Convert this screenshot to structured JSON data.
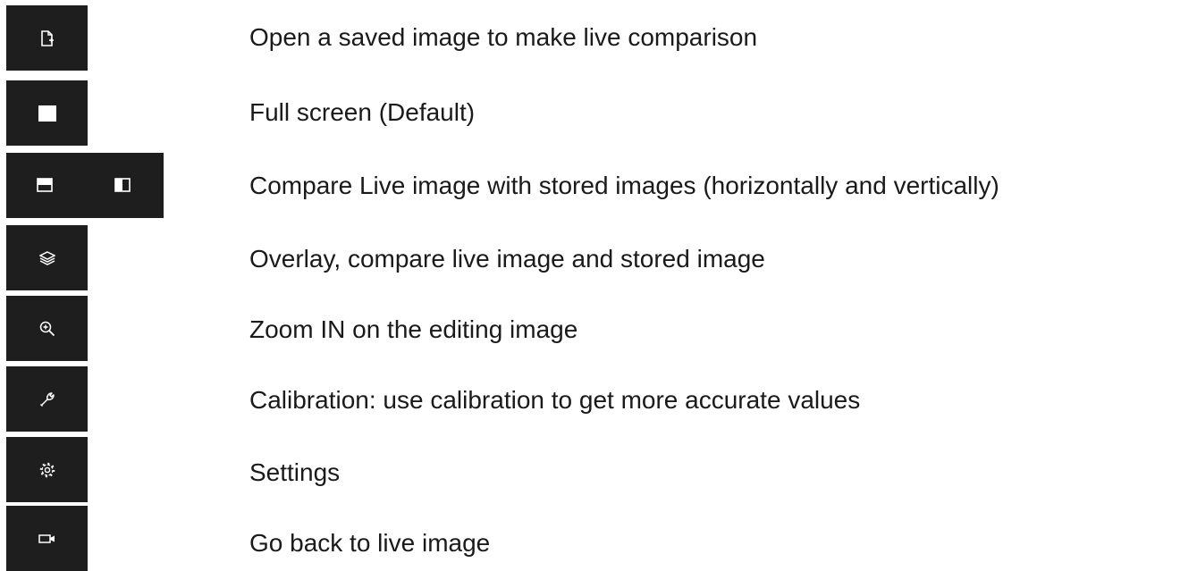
{
  "rows": [
    {
      "icon": "open-file-icon",
      "label": "Open a saved image to make live comparison"
    },
    {
      "icon": "full-screen-icon",
      "label": "Full screen (Default)"
    },
    {
      "icon": "split-horizontal-icon",
      "icon2": "split-vertical-icon",
      "label": "Compare Live image with stored images (horizontally and vertically)"
    },
    {
      "icon": "layers-icon",
      "label": "Overlay, compare live image and stored image"
    },
    {
      "icon": "zoom-in-icon",
      "label": "Zoom IN on the editing image"
    },
    {
      "icon": "wrench-icon",
      "label": "Calibration: use calibration to get more accurate values"
    },
    {
      "icon": "gear-icon",
      "label": "Settings"
    },
    {
      "icon": "camera-icon",
      "label": "Go back to live image"
    }
  ],
  "colors": {
    "tile_bg": "#1e1e1e",
    "icon": "#ffffff",
    "text": "#1a1a1a"
  }
}
